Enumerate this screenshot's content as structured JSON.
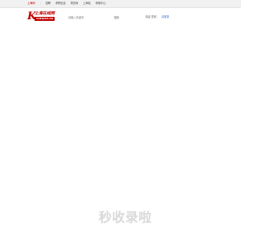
{
  "topbar": {
    "nav": [
      {
        "label": "上海网",
        "active": true
      },
      {
        "label": "招聘",
        "active": false
      },
      {
        "label": "求职信息",
        "active": false
      },
      {
        "label": "简历库",
        "active": false
      },
      {
        "label": "上海站",
        "active": false
      },
      {
        "label": "帮助中心",
        "active": false
      }
    ]
  },
  "header": {
    "logo": {
      "mark": "K",
      "name_cn": "上海在线网",
      "name_en": "YUEQISH.CN"
    },
    "search": {
      "placeholder": "请输入关键词",
      "button_label": "搜索"
    },
    "user": {
      "greeting": "欢迎 您好，",
      "login_link": "请登录"
    }
  },
  "watermark": "秒收录啦",
  "colors": {
    "brand": "#c00000",
    "link": "#2a6ad6",
    "watermark": "#d9d9d9"
  }
}
